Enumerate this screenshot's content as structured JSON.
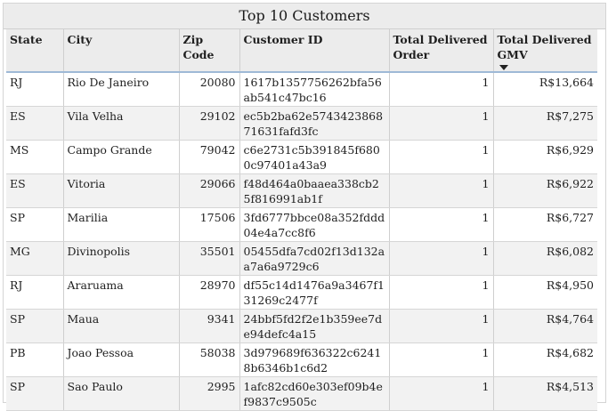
{
  "title": "Top 10 Customers",
  "columns": {
    "state": "State",
    "city": "City",
    "zip": "Zip Code",
    "customer_id": "Customer ID",
    "orders": "Total Delivered Order",
    "gmv": "Total Delivered GMV"
  },
  "sort": {
    "column": "gmv",
    "direction": "descending",
    "icon": "sort-descending-icon"
  },
  "colors": {
    "header_bg": "#ececec",
    "row_alt": "#f2f2f2",
    "header_rule": "#9fb9d6"
  },
  "rows": [
    {
      "state": "RJ",
      "city": "Rio De Janeiro",
      "zip": "20080",
      "customer_id": "1617b1357756262bfa56ab541c47bc16",
      "orders": "1",
      "gmv": "R$13,664"
    },
    {
      "state": "ES",
      "city": "Vila Velha",
      "zip": "29102",
      "customer_id": "ec5b2ba62e574342386871631fafd3fc",
      "orders": "1",
      "gmv": "R$7,275"
    },
    {
      "state": "MS",
      "city": "Campo Grande",
      "zip": "79042",
      "customer_id": "c6e2731c5b391845f6800c97401a43a9",
      "orders": "1",
      "gmv": "R$6,929"
    },
    {
      "state": "ES",
      "city": "Vitoria",
      "zip": "29066",
      "customer_id": "f48d464a0baaea338cb25f816991ab1f",
      "orders": "1",
      "gmv": "R$6,922"
    },
    {
      "state": "SP",
      "city": "Marilia",
      "zip": "17506",
      "customer_id": "3fd6777bbce08a352fddd04e4a7cc8f6",
      "orders": "1",
      "gmv": "R$6,727"
    },
    {
      "state": "MG",
      "city": "Divinopolis",
      "zip": "35501",
      "customer_id": "05455dfa7cd02f13d132aa7a6a9729c6",
      "orders": "1",
      "gmv": "R$6,082"
    },
    {
      "state": "RJ",
      "city": "Araruama",
      "zip": "28970",
      "customer_id": "df55c14d1476a9a3467f131269c2477f",
      "orders": "1",
      "gmv": "R$4,950"
    },
    {
      "state": "SP",
      "city": "Maua",
      "zip": "9341",
      "customer_id": "24bbf5fd2f2e1b359ee7de94defc4a15",
      "orders": "1",
      "gmv": "R$4,764"
    },
    {
      "state": "PB",
      "city": "Joao Pessoa",
      "zip": "58038",
      "customer_id": "3d979689f636322c62418b6346b1c6d2",
      "orders": "1",
      "gmv": "R$4,682"
    },
    {
      "state": "SP",
      "city": "Sao Paulo",
      "zip": "2995",
      "customer_id": "1afc82cd60e303ef09b4ef9837c9505c",
      "orders": "1",
      "gmv": "R$4,513"
    }
  ]
}
